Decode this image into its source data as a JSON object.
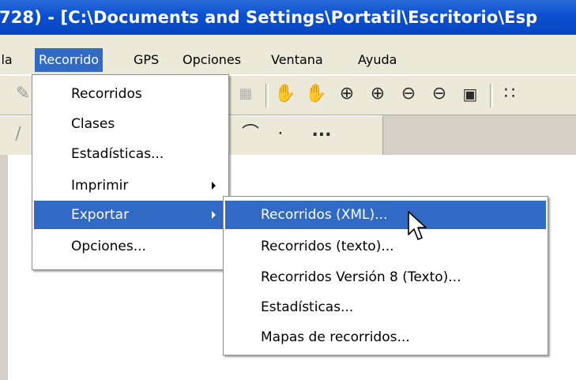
{
  "window": {
    "title": "728) - [C:\\Documents and Settings\\Portatil\\Escritorio\\Esp"
  },
  "menubar": {
    "items": [
      {
        "label": "lla"
      },
      {
        "label": "Recorrido"
      },
      {
        "label": "GPS"
      },
      {
        "label": "Opciones"
      },
      {
        "label": "Ventana"
      },
      {
        "label": "Ayuda"
      }
    ]
  },
  "recorrido_menu": {
    "items": [
      {
        "label": "Recorridos"
      },
      {
        "label": "Clases"
      },
      {
        "label": "Estadísticas..."
      },
      {
        "label": "Imprimir"
      },
      {
        "label": "Exportar"
      },
      {
        "label": "Opciones..."
      }
    ]
  },
  "exportar_submenu": {
    "items": [
      {
        "label": "Recorridos (XML)..."
      },
      {
        "label": "Recorridos (texto)..."
      },
      {
        "label": "Recorridos Versión 8 (Texto)..."
      },
      {
        "label": "Estadísticas..."
      },
      {
        "label": "Mapas de recorridos..."
      }
    ]
  },
  "toolbar2": {
    "more_label": "..."
  },
  "colors": {
    "titlebar": "#0b4fd0",
    "highlight": "#316ac5",
    "menubar": "#ece9d8"
  }
}
